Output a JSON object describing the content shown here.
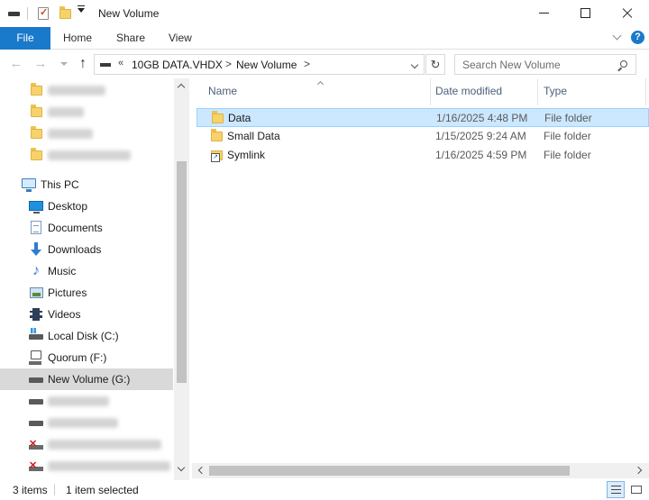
{
  "window": {
    "title": "New Volume",
    "controls": [
      "minimize",
      "maximize",
      "close"
    ]
  },
  "quick_access_toolbar": [
    "drive-icon",
    "properties-icon",
    "new-folder-icon",
    "customize-dropdown"
  ],
  "ribbon": {
    "file_tab": "File",
    "tabs": [
      "Home",
      "Share",
      "View"
    ]
  },
  "address_bar": {
    "overflow": "«",
    "segments": [
      "10GB DATA.VHDX",
      "New Volume"
    ],
    "separator": ">"
  },
  "search": {
    "placeholder": "Search New Volume"
  },
  "navigation": {
    "quick_access_blurred_count": 4,
    "this_pc_label": "This PC",
    "items": [
      {
        "label": "Desktop",
        "icon": "desktop-icon"
      },
      {
        "label": "Documents",
        "icon": "documents-icon"
      },
      {
        "label": "Downloads",
        "icon": "downloads-icon"
      },
      {
        "label": "Music",
        "icon": "music-icon"
      },
      {
        "label": "Pictures",
        "icon": "pictures-icon"
      },
      {
        "label": "Videos",
        "icon": "videos-icon"
      },
      {
        "label": "Local Disk (C:)",
        "icon": "local-disk-icon"
      },
      {
        "label": "Quorum (F:)",
        "icon": "network-drive-icon"
      },
      {
        "label": "New Volume (G:)",
        "icon": "drive-icon",
        "selected": true
      }
    ],
    "blurred_drive_count": 4
  },
  "file_list": {
    "columns": {
      "name": "Name",
      "date": "Date modified",
      "type": "Type"
    },
    "rows": [
      {
        "name": "Data",
        "date": "1/16/2025 4:48 PM",
        "type": "File folder",
        "selected": true,
        "icon": "folder-icon"
      },
      {
        "name": "Small Data",
        "date": "1/15/2025 9:24 AM",
        "type": "File folder",
        "selected": false,
        "icon": "folder-icon"
      },
      {
        "name": "Symlink",
        "date": "1/16/2025 4:59 PM",
        "type": "File folder",
        "selected": false,
        "icon": "shortcut-folder-icon"
      }
    ]
  },
  "status_bar": {
    "item_count": "3 items",
    "selection": "1 item selected"
  },
  "colors": {
    "accent": "#1979ca",
    "selection_bg": "#cce8ff",
    "selection_border": "#99d1ff",
    "nav_selected_bg": "#d9d9d9",
    "folder": "#f7d26b"
  }
}
